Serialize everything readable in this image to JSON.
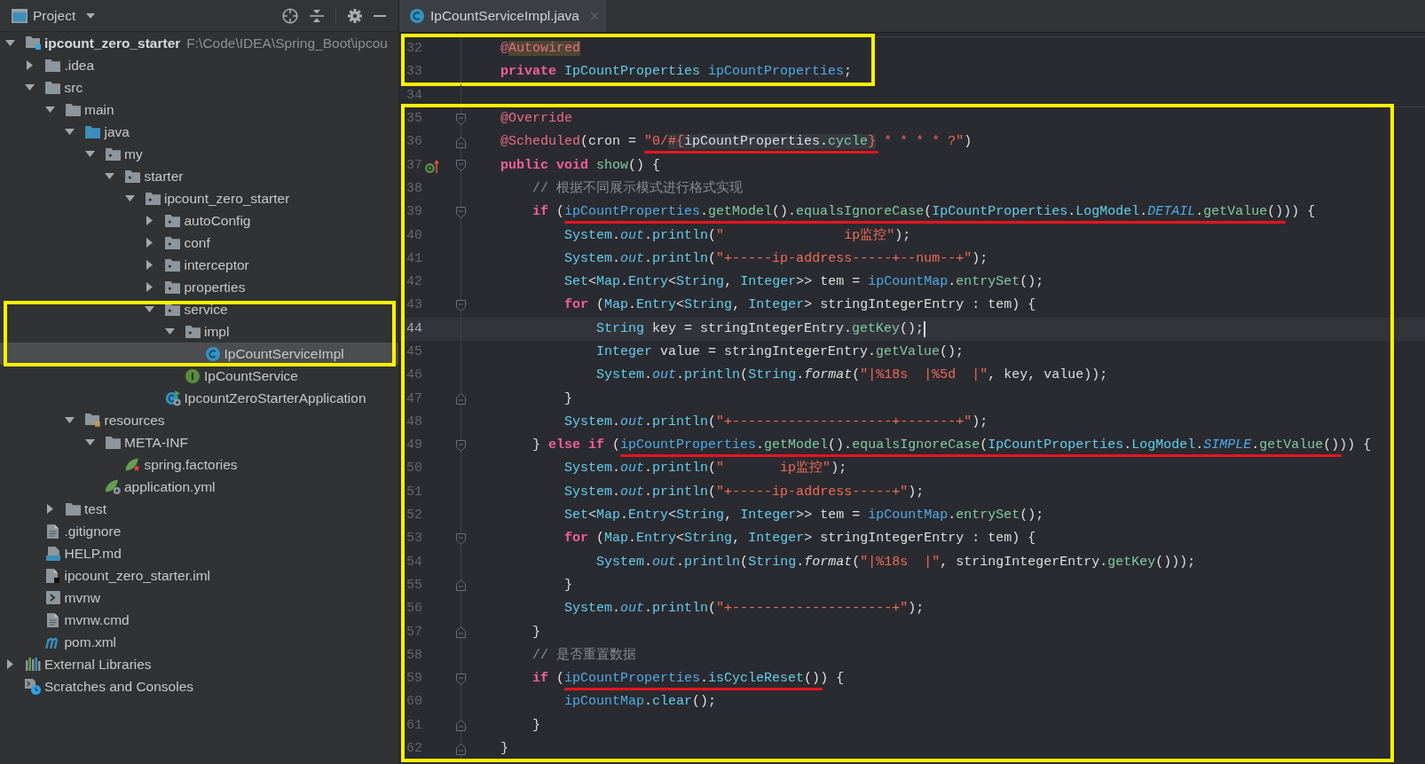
{
  "project_panel": {
    "title": "Project",
    "tree": [
      {
        "label": "ipcount_zero_starter",
        "path": "F:\\Code\\IDEA\\Spring_Boot\\ipcou",
        "kind": "module",
        "expanded": true,
        "selected": false,
        "children": [
          {
            "label": ".idea",
            "kind": "folder",
            "expanded": false,
            "selected": false
          },
          {
            "label": "src",
            "kind": "folder",
            "expanded": true,
            "selected": false,
            "children": [
              {
                "label": "main",
                "kind": "folder",
                "expanded": true,
                "selected": false,
                "children": [
                  {
                    "label": "java",
                    "kind": "source_root",
                    "expanded": true,
                    "selected": false,
                    "children": [
                      {
                        "label": "my",
                        "kind": "package",
                        "expanded": true,
                        "selected": false,
                        "children": [
                          {
                            "label": "starter",
                            "kind": "package",
                            "expanded": true,
                            "selected": false,
                            "children": [
                              {
                                "label": "ipcount_zero_starter",
                                "kind": "package",
                                "expanded": true,
                                "selected": false,
                                "children": [
                                  {
                                    "label": "autoConfig",
                                    "kind": "package",
                                    "expanded": false,
                                    "selected": false
                                  },
                                  {
                                    "label": "conf",
                                    "kind": "package",
                                    "expanded": false,
                                    "selected": false
                                  },
                                  {
                                    "label": "interceptor",
                                    "kind": "package",
                                    "expanded": false,
                                    "selected": false
                                  },
                                  {
                                    "label": "properties",
                                    "kind": "package",
                                    "expanded": false,
                                    "selected": false
                                  },
                                  {
                                    "label": "service",
                                    "kind": "package",
                                    "expanded": true,
                                    "selected": false,
                                    "framed": true,
                                    "children": [
                                      {
                                        "label": "impl",
                                        "kind": "package",
                                        "expanded": true,
                                        "selected": false,
                                        "framed": true,
                                        "children": [
                                          {
                                            "label": "IpCountServiceImpl",
                                            "kind": "class",
                                            "selected": true,
                                            "framed": true
                                          }
                                        ]
                                      },
                                      {
                                        "label": "IpCountService",
                                        "kind": "interface",
                                        "selected": false
                                      }
                                    ]
                                  },
                                  {
                                    "label": "IpcountZeroStarterApplication",
                                    "kind": "spring_app",
                                    "selected": false
                                  }
                                ]
                              }
                            ]
                          }
                        ]
                      }
                    ]
                  },
                  {
                    "label": "resources",
                    "kind": "resources",
                    "expanded": true,
                    "selected": false,
                    "children": [
                      {
                        "label": "META-INF",
                        "kind": "folder",
                        "expanded": true,
                        "selected": false,
                        "children": [
                          {
                            "label": "spring.factories",
                            "kind": "spring_factories",
                            "selected": false
                          }
                        ]
                      },
                      {
                        "label": "application.yml",
                        "kind": "spring_config",
                        "selected": false
                      }
                    ]
                  }
                ]
              },
              {
                "label": "test",
                "kind": "folder",
                "expanded": false,
                "selected": false
              }
            ]
          },
          {
            "label": ".gitignore",
            "kind": "text_file",
            "selected": false
          },
          {
            "label": "HELP.md",
            "kind": "markdown",
            "selected": false
          },
          {
            "label": "ipcount_zero_starter.iml",
            "kind": "iml",
            "selected": false
          },
          {
            "label": "mvnw",
            "kind": "shell",
            "selected": false
          },
          {
            "label": "mvnw.cmd",
            "kind": "text_file",
            "selected": false
          },
          {
            "label": "pom.xml",
            "kind": "maven",
            "selected": false
          }
        ]
      },
      {
        "label": "External Libraries",
        "kind": "libraries",
        "expanded": false,
        "selected": false
      },
      {
        "label": "Scratches and Consoles",
        "kind": "scratches",
        "selected": false
      }
    ]
  },
  "editor": {
    "tabs": [
      {
        "label": "IpCountServiceImpl.java",
        "kind": "class",
        "selected": true
      }
    ],
    "blocks": [
      {
        "framed": true,
        "separator": true,
        "lines": [
          {
            "number": "32",
            "tokens": [
              {
                "kind": "annotation",
                "text": "    @"
              },
              {
                "kind": "warned",
                "tokens": [
                  {
                    "kind": "annotation",
                    "text": "Autowired"
                  }
                ]
              }
            ]
          },
          {
            "number": "33",
            "tokens": [
              {
                "kind": "keyword",
                "text": "    private"
              },
              {
                "kind": "type",
                "text": " IpCountProperties"
              },
              {
                "kind": "field",
                "text": " ipCountProperties"
              },
              {
                "kind": "plain",
                "text": ";"
              }
            ]
          }
        ]
      },
      {
        "framed": false,
        "separator": false,
        "lines": [
          {
            "number": "34"
          }
        ]
      },
      {
        "framed": true,
        "separator": true,
        "lines": [
          {
            "number": "35",
            "gutter": [
              {
                "kind": "fold_start"
              }
            ],
            "tokens": [
              {
                "kind": "annotation",
                "text": "    @Override"
              }
            ]
          },
          {
            "number": "36",
            "gutter": [
              {
                "kind": "fold_end"
              }
            ],
            "tokens": [
              {
                "kind": "annotation",
                "text": "    @Scheduled"
              },
              {
                "kind": "plain",
                "text": "(cron = "
              },
              {
                "kind": "underlined",
                "tokens": [
                  {
                    "kind": "string",
                    "text": "\"0/"
                  },
                  {
                    "kind": "injected",
                    "tokens": [
                      {
                        "kind": "string",
                        "text": "#{"
                      },
                      {
                        "kind": "plain",
                        "text": "ipCountProperties."
                      },
                      {
                        "kind": "method",
                        "text": "cycle"
                      },
                      {
                        "kind": "string",
                        "text": "}"
                      }
                    ]
                  }
                ]
              },
              {
                "kind": "string",
                "text": " * * * * ?\""
              },
              {
                "kind": "plain",
                "text": ")"
              }
            ]
          },
          {
            "number": "37",
            "gutter": [
              {
                "kind": "overrides"
              },
              {
                "kind": "fold_start"
              }
            ],
            "tokens": [
              {
                "kind": "keyword",
                "text": "    public void"
              },
              {
                "kind": "method",
                "text": " show"
              },
              {
                "kind": "plain",
                "text": "() {"
              }
            ]
          },
          {
            "number": "38",
            "tokens": [
              {
                "kind": "comment",
                "text": "        // 根据不同展示模式进行格式实现"
              }
            ]
          },
          {
            "number": "39",
            "gutter": [
              {
                "kind": "fold_start"
              }
            ],
            "tokens": [
              {
                "kind": "keyword",
                "text": "        if"
              },
              {
                "kind": "plain",
                "text": " ("
              },
              {
                "kind": "underlined",
                "tokens": [
                  {
                    "kind": "field",
                    "text": "ipCountProperties"
                  },
                  {
                    "kind": "plain",
                    "text": "."
                  },
                  {
                    "kind": "method",
                    "text": "getModel"
                  },
                  {
                    "kind": "plain",
                    "text": "()."
                  },
                  {
                    "kind": "method",
                    "text": "equalsIgnoreCase"
                  },
                  {
                    "kind": "plain",
                    "text": "("
                  },
                  {
                    "kind": "type",
                    "text": "IpCountProperties"
                  },
                  {
                    "kind": "plain",
                    "text": "."
                  },
                  {
                    "kind": "type",
                    "text": "LogModel"
                  },
                  {
                    "kind": "plain",
                    "text": "."
                  },
                  {
                    "kind": "constant",
                    "text": "DETAIL"
                  },
                  {
                    "kind": "plain",
                    "text": "."
                  },
                  {
                    "kind": "method",
                    "text": "getValue"
                  },
                  {
                    "kind": "plain",
                    "text": "()"
                  }
                ]
              },
              {
                "kind": "plain",
                "text": ")) {"
              }
            ]
          },
          {
            "number": "40",
            "tokens": [
              {
                "kind": "type",
                "text": "            System"
              },
              {
                "kind": "plain",
                "text": "."
              },
              {
                "kind": "static_field",
                "text": "out"
              },
              {
                "kind": "plain",
                "text": "."
              },
              {
                "kind": "call",
                "text": "println"
              },
              {
                "kind": "plain",
                "text": "("
              },
              {
                "kind": "string",
                "text": "\"               ip监控\""
              },
              {
                "kind": "plain",
                "text": ");"
              }
            ]
          },
          {
            "number": "41",
            "tokens": [
              {
                "kind": "type",
                "text": "            System"
              },
              {
                "kind": "plain",
                "text": "."
              },
              {
                "kind": "static_field",
                "text": "out"
              },
              {
                "kind": "plain",
                "text": "."
              },
              {
                "kind": "call",
                "text": "println"
              },
              {
                "kind": "plain",
                "text": "("
              },
              {
                "kind": "string",
                "text": "\"+-----ip-address-----+--num--+\""
              },
              {
                "kind": "plain",
                "text": ");"
              }
            ]
          },
          {
            "number": "42",
            "tokens": [
              {
                "kind": "type",
                "text": "            Set"
              },
              {
                "kind": "plain",
                "text": "<"
              },
              {
                "kind": "type",
                "text": "Map"
              },
              {
                "kind": "plain",
                "text": "."
              },
              {
                "kind": "type",
                "text": "Entry"
              },
              {
                "kind": "plain",
                "text": "<"
              },
              {
                "kind": "type",
                "text": "String"
              },
              {
                "kind": "plain",
                "text": ", "
              },
              {
                "kind": "type",
                "text": "Integer"
              },
              {
                "kind": "plain",
                "text": ">> tem = "
              },
              {
                "kind": "field",
                "text": "ipCountMap"
              },
              {
                "kind": "plain",
                "text": "."
              },
              {
                "kind": "method",
                "text": "entrySet"
              },
              {
                "kind": "plain",
                "text": "();"
              }
            ]
          },
          {
            "number": "43",
            "gutter": [
              {
                "kind": "fold_start"
              }
            ],
            "tokens": [
              {
                "kind": "keyword",
                "text": "            for"
              },
              {
                "kind": "plain",
                "text": " ("
              },
              {
                "kind": "type",
                "text": "Map"
              },
              {
                "kind": "plain",
                "text": "."
              },
              {
                "kind": "type",
                "text": "Entry"
              },
              {
                "kind": "plain",
                "text": "<"
              },
              {
                "kind": "type",
                "text": "String"
              },
              {
                "kind": "plain",
                "text": ", "
              },
              {
                "kind": "type",
                "text": "Integer"
              },
              {
                "kind": "plain",
                "text": "> stringIntegerEntry : tem) {"
              }
            ]
          },
          {
            "number": "44",
            "current": true,
            "tokens": [
              {
                "kind": "type",
                "text": "                String"
              },
              {
                "kind": "plain",
                "text": " key = stringIntegerEntry."
              },
              {
                "kind": "method",
                "text": "getKey"
              },
              {
                "kind": "plain",
                "text": "();"
              }
            ]
          },
          {
            "number": "45",
            "tokens": [
              {
                "kind": "type",
                "text": "                Integer"
              },
              {
                "kind": "plain",
                "text": " value = stringIntegerEntry."
              },
              {
                "kind": "method",
                "text": "getValue"
              },
              {
                "kind": "plain",
                "text": "();"
              }
            ]
          },
          {
            "number": "46",
            "tokens": [
              {
                "kind": "type",
                "text": "                System"
              },
              {
                "kind": "plain",
                "text": "."
              },
              {
                "kind": "static_field",
                "text": "out"
              },
              {
                "kind": "plain",
                "text": "."
              },
              {
                "kind": "call",
                "text": "println"
              },
              {
                "kind": "plain",
                "text": "("
              },
              {
                "kind": "type",
                "text": "String"
              },
              {
                "kind": "plain",
                "text": "."
              },
              {
                "kind": "static_method",
                "text": "format"
              },
              {
                "kind": "plain",
                "text": "("
              },
              {
                "kind": "string",
                "text": "\"|%18s  |%5d  |\""
              },
              {
                "kind": "plain",
                "text": ", key, value));"
              }
            ]
          },
          {
            "number": "47",
            "gutter": [
              {
                "kind": "fold_end"
              }
            ],
            "tokens": [
              {
                "kind": "plain",
                "text": "            }"
              }
            ]
          },
          {
            "number": "48",
            "tokens": [
              {
                "kind": "type",
                "text": "            System"
              },
              {
                "kind": "plain",
                "text": "."
              },
              {
                "kind": "static_field",
                "text": "out"
              },
              {
                "kind": "plain",
                "text": "."
              },
              {
                "kind": "call",
                "text": "println"
              },
              {
                "kind": "plain",
                "text": "("
              },
              {
                "kind": "string",
                "text": "\"+--------------------+-------+\""
              },
              {
                "kind": "plain",
                "text": ");"
              }
            ]
          },
          {
            "number": "49",
            "gutter": [
              {
                "kind": "fold_start"
              }
            ],
            "tokens": [
              {
                "kind": "plain",
                "text": "        } "
              },
              {
                "kind": "keyword",
                "text": "else if"
              },
              {
                "kind": "plain",
                "text": " ("
              },
              {
                "kind": "underlined",
                "tokens": [
                  {
                    "kind": "field",
                    "text": "ipCountProperties"
                  },
                  {
                    "kind": "plain",
                    "text": "."
                  },
                  {
                    "kind": "method",
                    "text": "getModel"
                  },
                  {
                    "kind": "plain",
                    "text": "()."
                  },
                  {
                    "kind": "method",
                    "text": "equalsIgnoreCase"
                  },
                  {
                    "kind": "plain",
                    "text": "("
                  },
                  {
                    "kind": "type",
                    "text": "IpCountProperties"
                  },
                  {
                    "kind": "plain",
                    "text": "."
                  },
                  {
                    "kind": "type",
                    "text": "LogModel"
                  },
                  {
                    "kind": "plain",
                    "text": "."
                  },
                  {
                    "kind": "constant",
                    "text": "SIMPLE"
                  },
                  {
                    "kind": "plain",
                    "text": "."
                  },
                  {
                    "kind": "method",
                    "text": "getValue"
                  },
                  {
                    "kind": "plain",
                    "text": "()"
                  }
                ]
              },
              {
                "kind": "plain",
                "text": ")) {"
              }
            ]
          },
          {
            "number": "50",
            "tokens": [
              {
                "kind": "type",
                "text": "            System"
              },
              {
                "kind": "plain",
                "text": "."
              },
              {
                "kind": "static_field",
                "text": "out"
              },
              {
                "kind": "plain",
                "text": "."
              },
              {
                "kind": "call",
                "text": "println"
              },
              {
                "kind": "plain",
                "text": "("
              },
              {
                "kind": "string",
                "text": "\"       ip监控\""
              },
              {
                "kind": "plain",
                "text": ");"
              }
            ]
          },
          {
            "number": "51",
            "tokens": [
              {
                "kind": "type",
                "text": "            System"
              },
              {
                "kind": "plain",
                "text": "."
              },
              {
                "kind": "static_field",
                "text": "out"
              },
              {
                "kind": "plain",
                "text": "."
              },
              {
                "kind": "call",
                "text": "println"
              },
              {
                "kind": "plain",
                "text": "("
              },
              {
                "kind": "string",
                "text": "\"+-----ip-address-----+\""
              },
              {
                "kind": "plain",
                "text": ");"
              }
            ]
          },
          {
            "number": "52",
            "tokens": [
              {
                "kind": "type",
                "text": "            Set"
              },
              {
                "kind": "plain",
                "text": "<"
              },
              {
                "kind": "type",
                "text": "Map"
              },
              {
                "kind": "plain",
                "text": "."
              },
              {
                "kind": "type",
                "text": "Entry"
              },
              {
                "kind": "plain",
                "text": "<"
              },
              {
                "kind": "type",
                "text": "String"
              },
              {
                "kind": "plain",
                "text": ", "
              },
              {
                "kind": "type",
                "text": "Integer"
              },
              {
                "kind": "plain",
                "text": ">> tem = "
              },
              {
                "kind": "field",
                "text": "ipCountMap"
              },
              {
                "kind": "plain",
                "text": "."
              },
              {
                "kind": "method",
                "text": "entrySet"
              },
              {
                "kind": "plain",
                "text": "();"
              }
            ]
          },
          {
            "number": "53",
            "gutter": [
              {
                "kind": "fold_start"
              }
            ],
            "tokens": [
              {
                "kind": "keyword",
                "text": "            for"
              },
              {
                "kind": "plain",
                "text": " ("
              },
              {
                "kind": "type",
                "text": "Map"
              },
              {
                "kind": "plain",
                "text": "."
              },
              {
                "kind": "type",
                "text": "Entry"
              },
              {
                "kind": "plain",
                "text": "<"
              },
              {
                "kind": "type",
                "text": "String"
              },
              {
                "kind": "plain",
                "text": ", "
              },
              {
                "kind": "type",
                "text": "Integer"
              },
              {
                "kind": "plain",
                "text": "> stringIntegerEntry : tem) {"
              }
            ]
          },
          {
            "number": "54",
            "tokens": [
              {
                "kind": "type",
                "text": "                System"
              },
              {
                "kind": "plain",
                "text": "."
              },
              {
                "kind": "static_field",
                "text": "out"
              },
              {
                "kind": "plain",
                "text": "."
              },
              {
                "kind": "call",
                "text": "println"
              },
              {
                "kind": "plain",
                "text": "("
              },
              {
                "kind": "type",
                "text": "String"
              },
              {
                "kind": "plain",
                "text": "."
              },
              {
                "kind": "static_method",
                "text": "format"
              },
              {
                "kind": "plain",
                "text": "("
              },
              {
                "kind": "string",
                "text": "\"|%18s  |\""
              },
              {
                "kind": "plain",
                "text": ", stringIntegerEntry."
              },
              {
                "kind": "method",
                "text": "getKey"
              },
              {
                "kind": "plain",
                "text": "()));"
              }
            ]
          },
          {
            "number": "55",
            "gutter": [
              {
                "kind": "fold_end"
              }
            ],
            "tokens": [
              {
                "kind": "plain",
                "text": "            }"
              }
            ]
          },
          {
            "number": "56",
            "tokens": [
              {
                "kind": "type",
                "text": "            System"
              },
              {
                "kind": "plain",
                "text": "."
              },
              {
                "kind": "static_field",
                "text": "out"
              },
              {
                "kind": "plain",
                "text": "."
              },
              {
                "kind": "call",
                "text": "println"
              },
              {
                "kind": "plain",
                "text": "("
              },
              {
                "kind": "string",
                "text": "\"+--------------------+\""
              },
              {
                "kind": "plain",
                "text": ");"
              }
            ]
          },
          {
            "number": "57",
            "gutter": [
              {
                "kind": "fold_end"
              }
            ],
            "tokens": [
              {
                "kind": "plain",
                "text": "        }"
              }
            ]
          },
          {
            "number": "58",
            "tokens": [
              {
                "kind": "comment",
                "text": "        // 是否重置数据"
              }
            ]
          },
          {
            "number": "59",
            "gutter": [
              {
                "kind": "fold_start"
              }
            ],
            "tokens": [
              {
                "kind": "keyword",
                "text": "        if"
              },
              {
                "kind": "plain",
                "text": " ("
              },
              {
                "kind": "underlined",
                "tokens": [
                  {
                    "kind": "field",
                    "text": "ipCountProperties"
                  },
                  {
                    "kind": "plain",
                    "text": "."
                  },
                  {
                    "kind": "call",
                    "text": "isCycleReset"
                  },
                  {
                    "kind": "plain",
                    "text": "()"
                  }
                ]
              },
              {
                "kind": "plain",
                "text": ") {"
              }
            ]
          },
          {
            "number": "60",
            "tokens": [
              {
                "kind": "field",
                "text": "            ipCountMap"
              },
              {
                "kind": "plain",
                "text": "."
              },
              {
                "kind": "call",
                "text": "clear"
              },
              {
                "kind": "plain",
                "text": "();"
              }
            ]
          },
          {
            "number": "61",
            "gutter": [
              {
                "kind": "fold_end"
              }
            ],
            "tokens": [
              {
                "kind": "plain",
                "text": "        }"
              }
            ]
          },
          {
            "number": "62",
            "gutter": [
              {
                "kind": "fold_end"
              }
            ],
            "tokens": [
              {
                "kind": "plain",
                "text": "    }"
              }
            ]
          }
        ]
      }
    ]
  }
}
